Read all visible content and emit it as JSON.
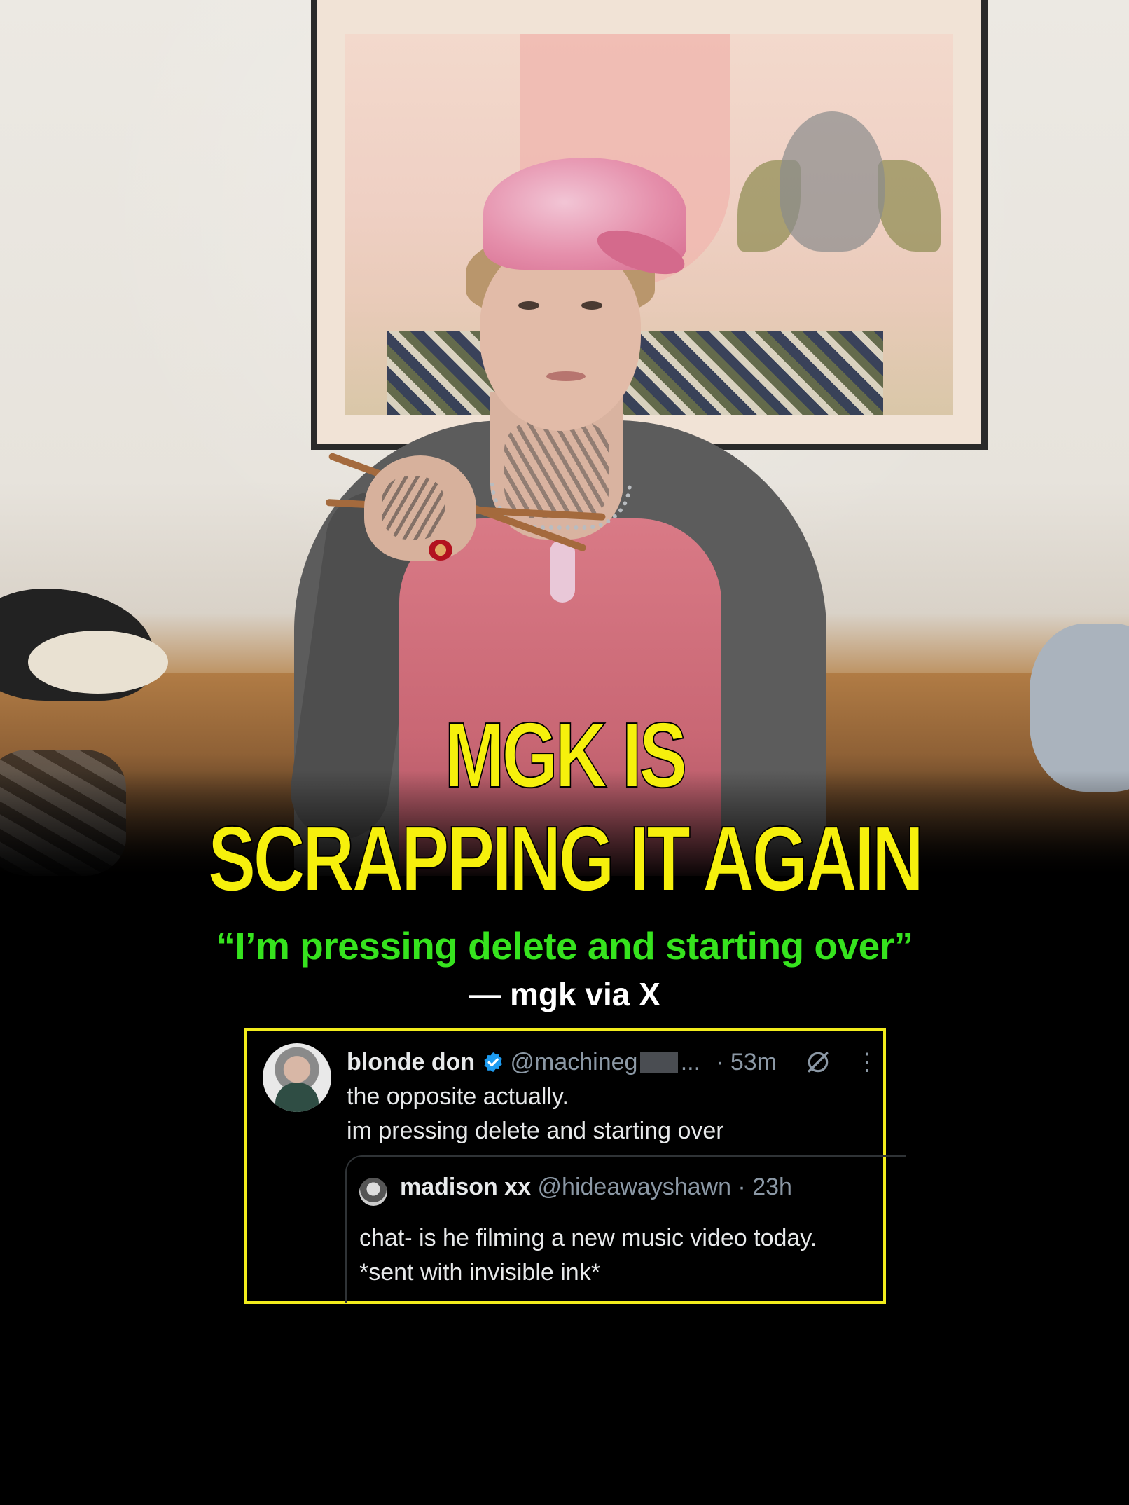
{
  "headline": {
    "line1": "MGK IS",
    "line2": "SCRAPPING IT AGAIN",
    "color": "#f6f00c"
  },
  "quote": {
    "text": "“I’m pressing delete and starting over”",
    "color": "#36e31e"
  },
  "attribution": "— mgk via X",
  "tweet": {
    "border_color": "#f2ec1c",
    "name": "blonde don",
    "verified_icon": "verified-badge-icon",
    "handle": "@machineg",
    "handle_ellipsis": "...",
    "time": "· 53m",
    "lines": [
      "the opposite actually.",
      "im pressing delete and starting over"
    ],
    "quoted": {
      "name": "madison xx",
      "handle": "@hideawayshawn · 23h",
      "lines": [
        "chat- is he filming a new music video today.",
        "*sent with invisible ink*"
      ]
    }
  }
}
